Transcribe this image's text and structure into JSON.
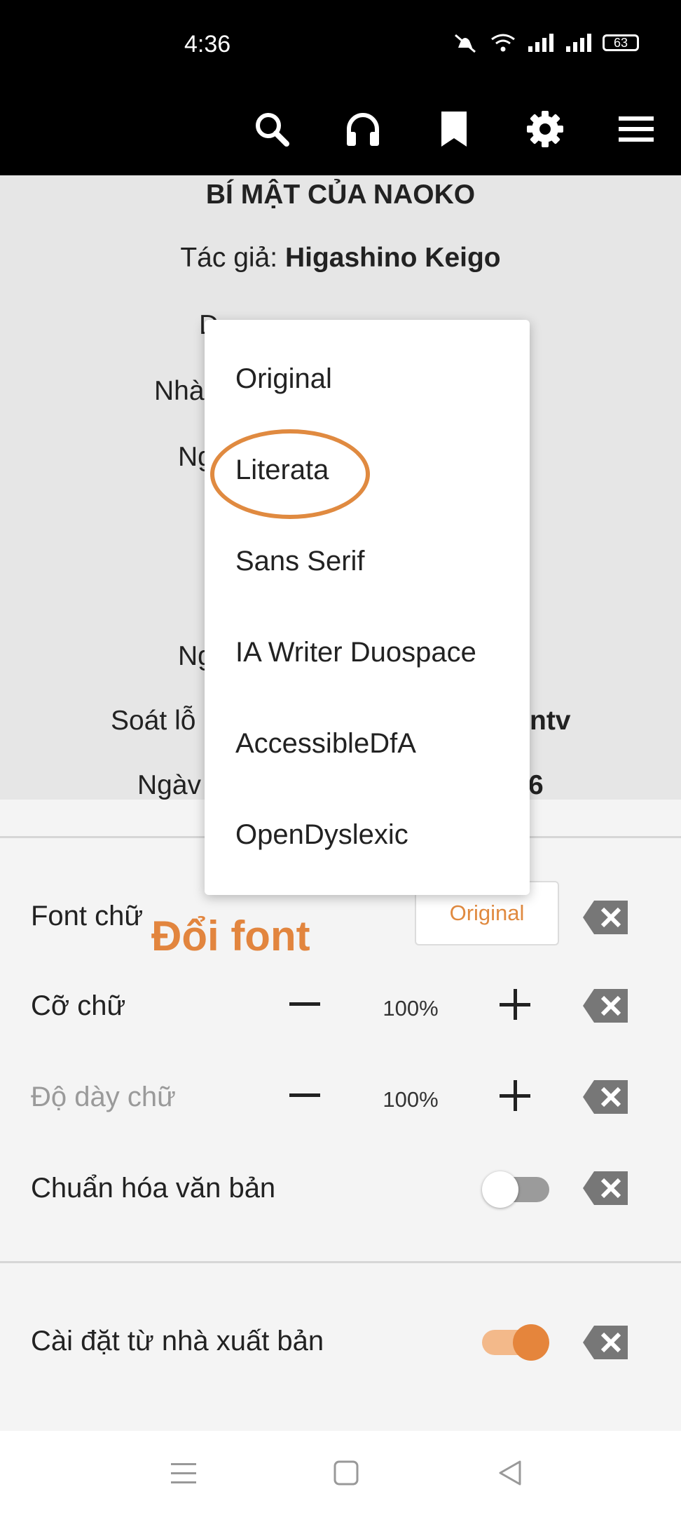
{
  "status": {
    "time": "4:36",
    "battery": "63"
  },
  "reader": {
    "title": "BÍ MẬT CỦA NAOKO",
    "author_label": "Tác giả: ",
    "author_name": "Higashino Keigo",
    "line_translator_fragment": "D",
    "line_publisher_fragment": "Nhà",
    "line_ng1_fragment": "Ng",
    "line_ng2_fragment": "Ng",
    "line_soat_fragment": "Soát lỗ",
    "line_soat_tail": "ntv",
    "line_ngay_fragment": "Ngàv",
    "line_ngay_tail": "6"
  },
  "dropdown": {
    "options": [
      "Original",
      "Literata",
      "Sans Serif",
      "IA Writer Duospace",
      "AccessibleDfA",
      "OpenDyslexic"
    ],
    "highlighted": "Literata"
  },
  "settings": {
    "font_label": "Font chữ",
    "font_value": "Original",
    "annotation": "Đổi font",
    "size_label": "Cỡ chữ",
    "size_value": "100%",
    "weight_label": "Độ dày chữ",
    "weight_value": "100%",
    "normalize_label": "Chuẩn hóa văn bản",
    "normalize_on": false,
    "publisher_label": "Cài đặt từ nhà xuất bản",
    "publisher_on": true
  },
  "colors": {
    "accent": "#e08a40",
    "annotation": "#e2853e",
    "toolbar": "#000000"
  }
}
